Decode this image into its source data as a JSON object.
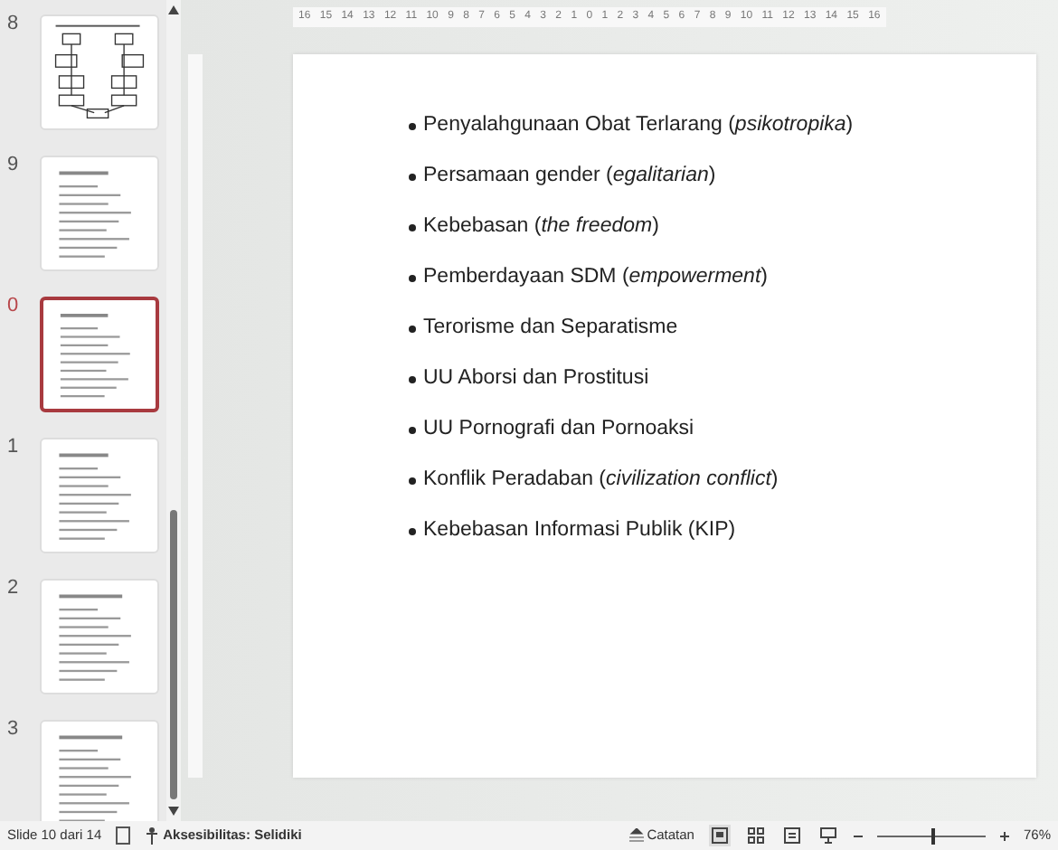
{
  "slide_panel": {
    "thumbnails": [
      {
        "number": "8",
        "selected": false,
        "kind": "diagram"
      },
      {
        "number": "9",
        "selected": false,
        "kind": "list"
      },
      {
        "number": "0",
        "selected": true,
        "kind": "list"
      },
      {
        "number": "1",
        "selected": false,
        "kind": "list"
      },
      {
        "number": "2",
        "selected": false,
        "kind": "text"
      },
      {
        "number": "3",
        "selected": false,
        "kind": "text"
      }
    ]
  },
  "ruler": {
    "labels": [
      "16",
      "15",
      "14",
      "13",
      "12",
      "11",
      "10",
      "9",
      "8",
      "7",
      "6",
      "5",
      "4",
      "3",
      "2",
      "1",
      "0",
      "1",
      "2",
      "3",
      "4",
      "5",
      "6",
      "7",
      "8",
      "9",
      "10",
      "11",
      "12",
      "13",
      "14",
      "15",
      "16"
    ]
  },
  "slide": {
    "bullets": [
      "Penyalahgunaan Obat Terlarang (*psikotropika*)",
      "Persamaan gender (*egalitarian*)",
      "Kebebasan (*the freedom*)",
      "Pemberdayaan SDM (*empowerment*)",
      "Terorisme dan Separatisme",
      "UU Aborsi dan Prostitusi",
      "UU Pornografi dan Pornoaksi",
      "Konflik Peradaban (*civilization conflict*)",
      "Kebebasan Informasi Publik (KIP)"
    ]
  },
  "status_bar": {
    "slide_info": "Slide 10 dari 14",
    "accessibility": "Aksesibilitas: Selidiki",
    "notes": "Catatan",
    "views": [
      {
        "selected": true
      },
      {
        "selected": false
      },
      {
        "selected": false
      },
      {
        "selected": false
      }
    ],
    "zoom": {
      "level": 0.52,
      "reading": "76%"
    }
  }
}
